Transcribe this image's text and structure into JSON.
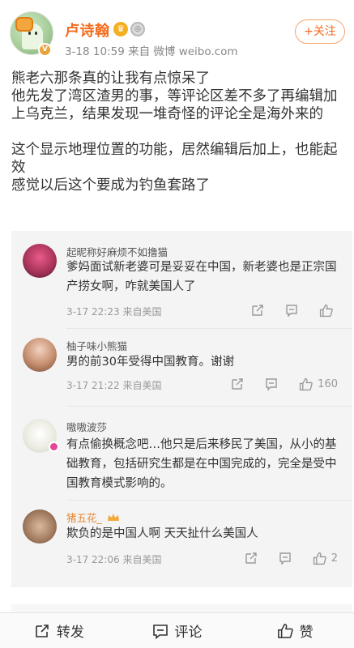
{
  "header": {
    "username": "卢诗翰",
    "meta": "3-18 10:59 来自 微博 weibo.com",
    "follow_label": "+关注",
    "level_icon": "king-crown-icon",
    "medal_icon": "silver-medal-icon"
  },
  "post": {
    "paragraph1": [
      "熊老六那条真的让我有点惊呆了",
      "他先发了湾区渣男的事，等评论区差不多了再编辑加上乌克兰，结果发现一堆奇怪的评论全是海外来的"
    ],
    "paragraph2": [
      "这个显示地理位置的功能，居然编辑后加上，也能起效",
      "感觉以后这个要成为钓鱼套路了"
    ]
  },
  "comments": [
    {
      "name": "起昵称好麻烦不如撸猫",
      "text": "爹妈面试新老婆可是妥妥在中国，新老婆也是正宗国产捞女啊，咋就美国人了",
      "time": "3-17 22:23 来自美国",
      "likes": ""
    },
    {
      "name": "柚子味小熊猫",
      "text": "男的前30年受得中国教育。谢谢",
      "time": "3-17 21:22 来自美国",
      "likes": "160"
    },
    {
      "name": "嗷嗷波莎",
      "text": "有点偷换概念吧…他只是后来移民了美国，从小的基础教育，包括研究生都是在中国完成的，完全是受中国教育模式影响的。",
      "time": "",
      "likes": ""
    },
    {
      "name": "猪五花_",
      "text": "欺负的是中国人啊 天天扯什么美国人",
      "time": "3-17 22:06 来自美国",
      "likes": "2"
    }
  ],
  "bottom_bar": {
    "repost": "转发",
    "comment": "评论",
    "like": "赞"
  },
  "colors": {
    "username": "#f36b1c",
    "meta": "#888888",
    "quote_bg": "#f4f4f4"
  }
}
